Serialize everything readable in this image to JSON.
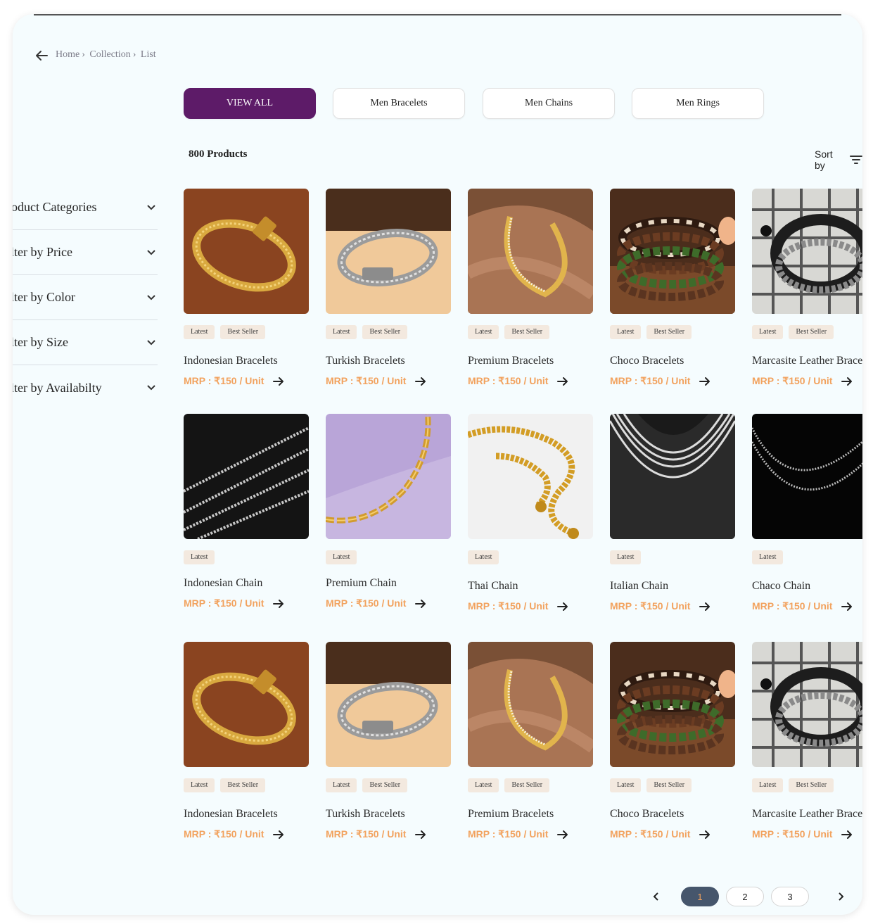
{
  "breadcrumb": {
    "home": "Home",
    "sep1": "›",
    "collection": "Collection",
    "sep2": "›",
    "list": "List"
  },
  "tabs": [
    "VIEW ALL",
    "Men Bracelets",
    "Men Chains",
    "Men Rings"
  ],
  "toolbar": {
    "count": "800 Products",
    "sort_label": "Sort by"
  },
  "filters": [
    "Product Categories",
    "Filter by Price",
    "Filter by Color",
    "Filter by Size",
    "Filter by Availabilty"
  ],
  "badge_latest": "Latest",
  "badge_best": "Best Seller",
  "rows": [
    [
      {
        "name": "Indonesian Bracelets",
        "price": "MRP : ₹150 / Unit",
        "image": "gold-bracelet-wood",
        "best": true
      },
      {
        "name": "Turkish Bracelets",
        "price": "MRP : ₹150 / Unit",
        "image": "silver-bracelet-beige",
        "best": true
      },
      {
        "name": "Premium Bracelets",
        "price": "MRP : ₹150 / Unit",
        "image": "gold-cuff-silk",
        "best": true
      },
      {
        "name": "Choco Bracelets",
        "price": "MRP : ₹150 / Unit",
        "image": "beaded-bracelets",
        "best": true
      },
      {
        "name": "Marcasite Leather Bracelets",
        "price": "MRP : ₹150 / Unit",
        "image": "leather-bracelet-check",
        "best": true
      }
    ],
    [
      {
        "name": "Indonesian Chain",
        "price": "MRP : ₹150 / Unit",
        "image": "silver-chains-black",
        "best": false
      },
      {
        "name": "Premium Chain",
        "price": "MRP : ₹150 / Unit",
        "image": "gold-chain-purple",
        "best": false
      },
      {
        "name": "Thai Chain",
        "price": "MRP : ₹150 / Unit",
        "image": "gold-chain-white",
        "best": false
      },
      {
        "name": "Italian Chain",
        "price": "MRP : ₹150 / Unit",
        "image": "silver-chains-bust",
        "best": false
      },
      {
        "name": "Chaco Chain",
        "price": "MRP : ₹150 / Unit",
        "image": "silver-chain-dark",
        "best": false
      }
    ],
    [
      {
        "name": "Indonesian Bracelets",
        "price": "MRP : ₹150 / Unit",
        "image": "gold-bracelet-wood",
        "best": true
      },
      {
        "name": "Turkish Bracelets",
        "price": "MRP : ₹150 / Unit",
        "image": "silver-bracelet-beige",
        "best": true
      },
      {
        "name": "Premium Bracelets",
        "price": "MRP : ₹150 / Unit",
        "image": "gold-cuff-silk",
        "best": true
      },
      {
        "name": "Choco Bracelets",
        "price": "MRP : ₹150 / Unit",
        "image": "beaded-bracelets",
        "best": true
      },
      {
        "name": "Marcasite Leather Bracelets",
        "price": "MRP : ₹150 / Unit",
        "image": "leather-bracelet-check",
        "best": true
      }
    ]
  ],
  "pagination": {
    "pages": [
      "1",
      "2",
      "3"
    ],
    "current": "1"
  },
  "colors": {
    "accent": "#5d1b68",
    "price": "#f2a25e",
    "badge_bg": "#f3e9df",
    "page_active": "#46566c",
    "bg": "#f5fcfe"
  }
}
